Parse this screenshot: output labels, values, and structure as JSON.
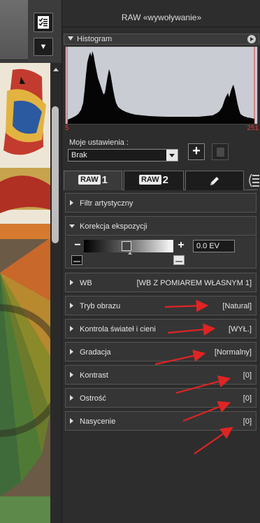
{
  "panel": {
    "title": "RAW «wywoływanie»"
  },
  "histogram": {
    "label": "Histogram",
    "min": "5",
    "max": "251"
  },
  "settings": {
    "label": "Moje ustawienia :",
    "preset_value": "Brak",
    "add_label": "+"
  },
  "toolbar": {
    "dropdown_glyph": "▼"
  },
  "tabs": [
    {
      "badge": "RAW",
      "num": "1"
    },
    {
      "badge": "RAW",
      "num": "2"
    }
  ],
  "sections": {
    "filtr": {
      "label": "Filtr artystyczny"
    },
    "korekcja": {
      "label": "Korekcja ekspozycji",
      "minus": "−",
      "plus": "+",
      "value": "0.0 EV"
    },
    "wb": {
      "label": "WB",
      "value": "[WB Z POMIAREM WŁASNYM 1]"
    },
    "tryb": {
      "label": "Tryb obrazu",
      "value": "[Natural]"
    },
    "kontrola": {
      "label": "Kontrola świateł i cieni",
      "value": "[WYŁ.]"
    },
    "gradacja": {
      "label": "Gradacja",
      "value": "[Normalny]"
    },
    "kontrast": {
      "label": "Kontrast",
      "value": "[0]"
    },
    "ostrosc": {
      "label": "Ostrość",
      "value": "[0]"
    },
    "nasycenie": {
      "label": "Nasycenie",
      "value": "[0]"
    }
  },
  "colors": {
    "annotation_red": "#e02424",
    "histogram_bg": "#c9ccd3",
    "range_red": "#e23c3c"
  }
}
